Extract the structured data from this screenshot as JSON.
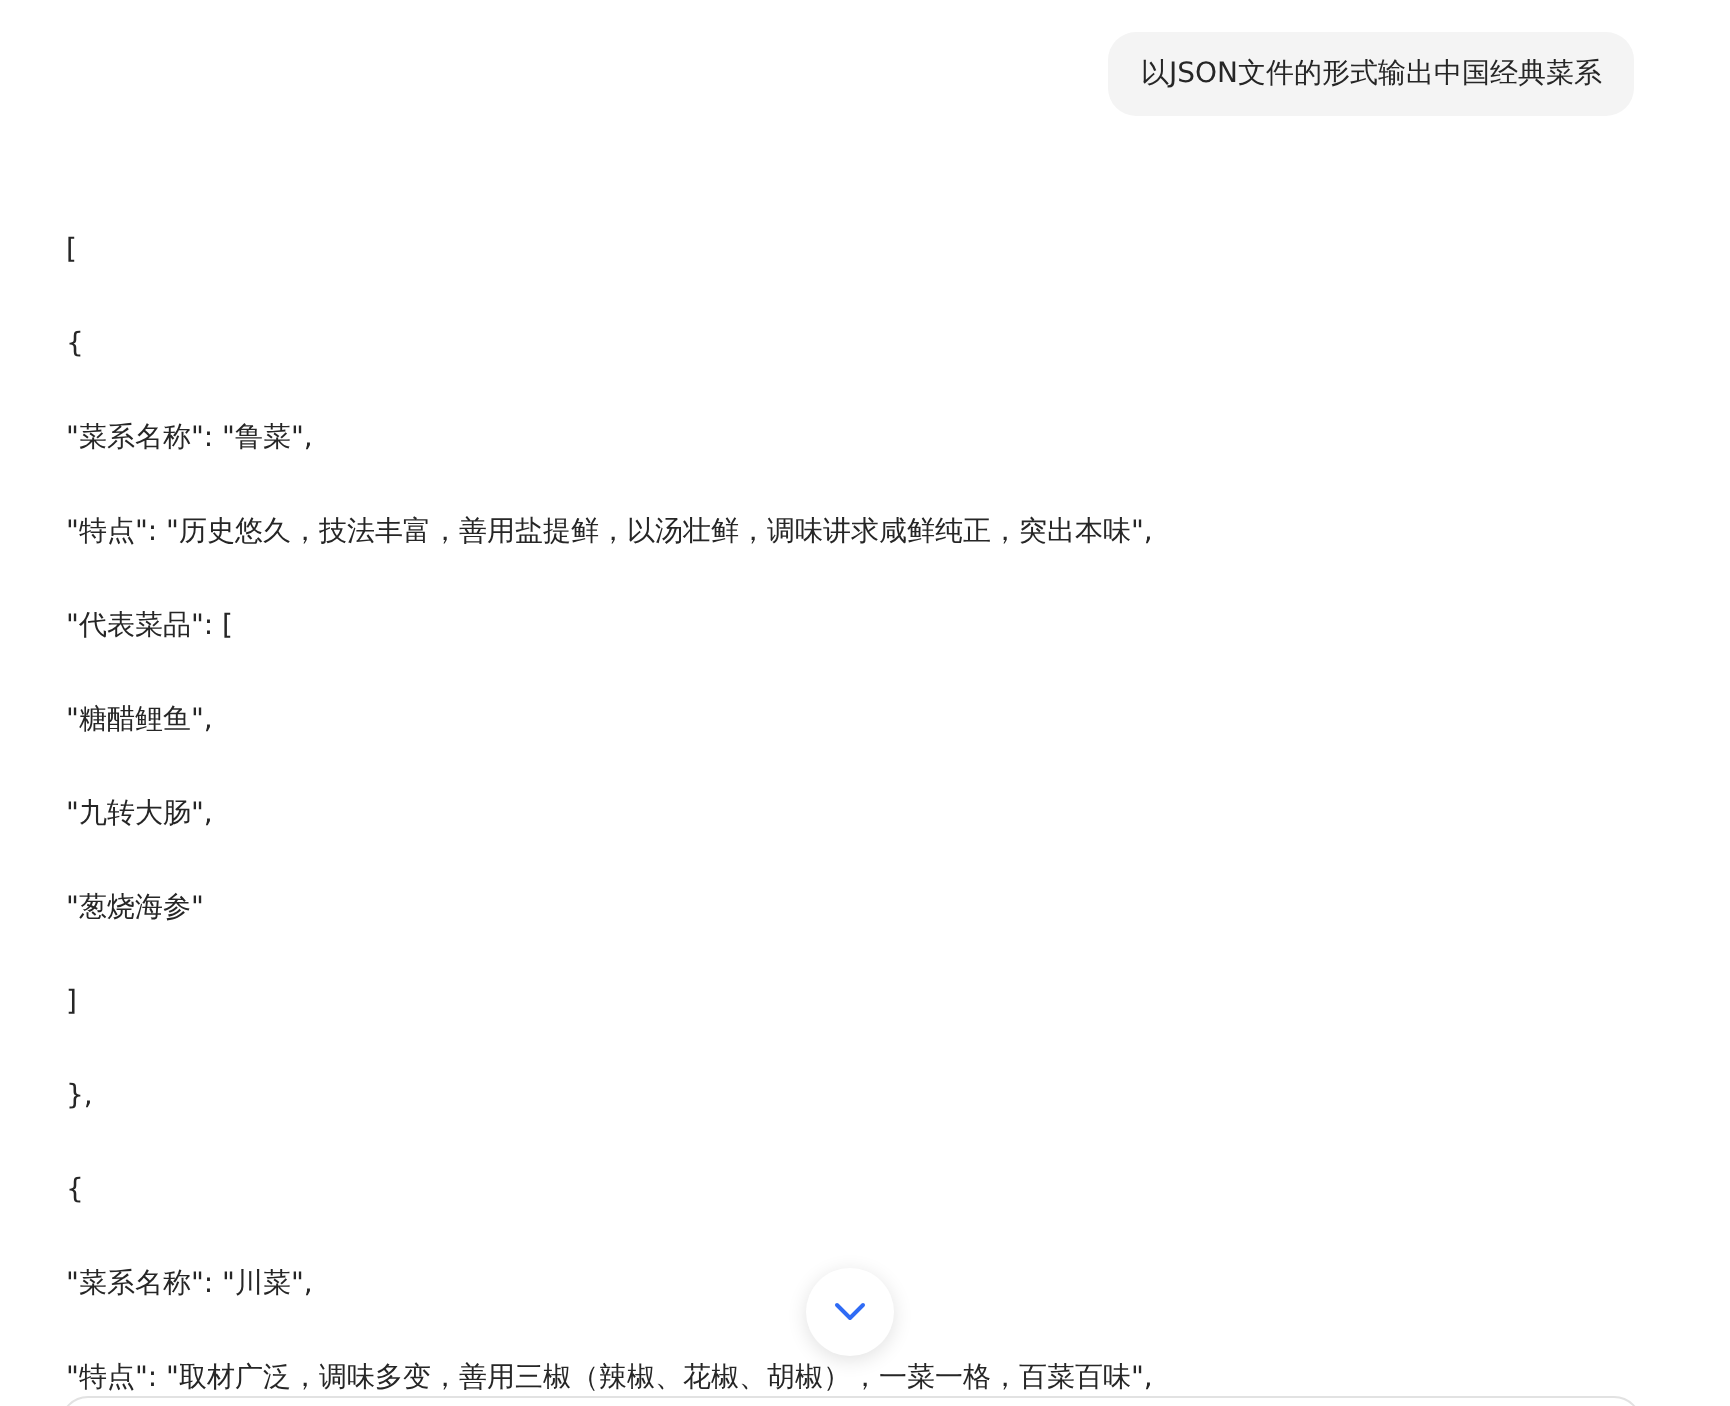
{
  "user_message": "以JSON文件的形式输出中国经典菜系",
  "response_lines": [
    "[",
    "{",
    "\"菜系名称\": \"鲁菜\",",
    "\"特点\": \"历史悠久，技法丰富，善用盐提鲜，以汤壮鲜，调味讲求咸鲜纯正，突出本味\",",
    "\"代表菜品\": [",
    "\"糖醋鲤鱼\",",
    "\"九转大肠\",",
    "\"葱烧海参\"",
    "]",
    "},",
    "{",
    "\"菜系名称\": \"川菜\",",
    "\"特点\": \"取材广泛，调味多变，善用三椒（辣椒、花椒、胡椒），一菜一格，百菜百味\","
  ]
}
